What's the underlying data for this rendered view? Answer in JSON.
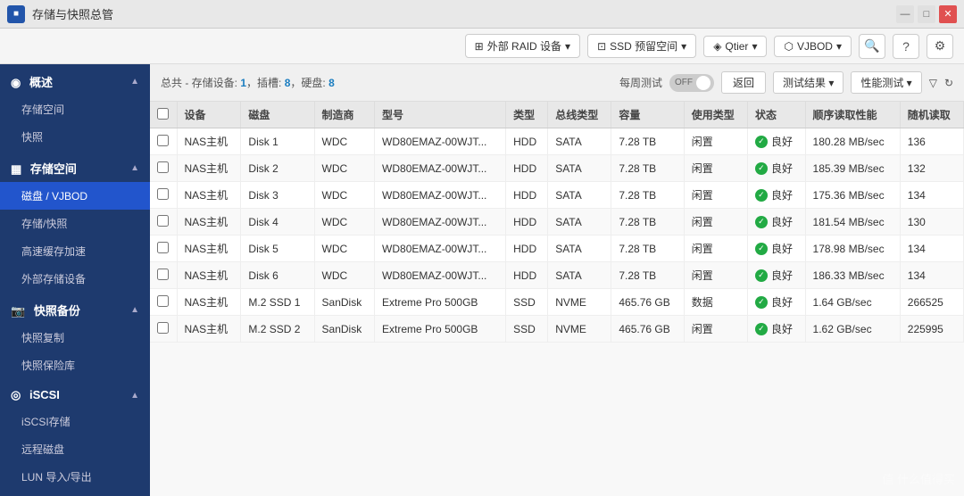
{
  "window": {
    "title": "存储与快照总管",
    "icon": "■",
    "buttons": {
      "minimize": "—",
      "maximize": "□",
      "close": "✕"
    }
  },
  "toolbar": {
    "btn1_label": "外部 RAID 设备",
    "btn2_label": "SSD 预留空间",
    "btn3_label": "Qtier",
    "btn4_label": "VJBOD",
    "icon1": "⚙",
    "icon2": "?",
    "icon3": "⚙"
  },
  "content_header": {
    "summary": "总共 - 存储设备: 1，插槽: 8，硬盘: 8",
    "label_test": "每周测试",
    "toggle": "OFF",
    "btn_return": "返回",
    "btn_test_result": "测试结果 ▾",
    "btn_performance": "性能测试 ▾"
  },
  "table": {
    "columns": [
      "",
      "设备",
      "磁盘",
      "制造商",
      "型号",
      "类型",
      "总线类型",
      "容量",
      "使用类型",
      "状态",
      "顺序读取性能",
      "随机读取"
    ],
    "rows": [
      {
        "checked": false,
        "device": "NAS主机",
        "disk": "Disk 1",
        "manufacturer": "WDC",
        "model": "WD80EMAZ-00WJT...",
        "type": "HDD",
        "bus": "SATA",
        "capacity": "7.28 TB",
        "usage": "闲置",
        "status": "良好",
        "seq_read": "180.28 MB/sec",
        "rand_read": "136"
      },
      {
        "checked": false,
        "device": "NAS主机",
        "disk": "Disk 2",
        "manufacturer": "WDC",
        "model": "WD80EMAZ-00WJT...",
        "type": "HDD",
        "bus": "SATA",
        "capacity": "7.28 TB",
        "usage": "闲置",
        "status": "良好",
        "seq_read": "185.39 MB/sec",
        "rand_read": "132"
      },
      {
        "checked": false,
        "device": "NAS主机",
        "disk": "Disk 3",
        "manufacturer": "WDC",
        "model": "WD80EMAZ-00WJT...",
        "type": "HDD",
        "bus": "SATA",
        "capacity": "7.28 TB",
        "usage": "闲置",
        "status": "良好",
        "seq_read": "175.36 MB/sec",
        "rand_read": "134"
      },
      {
        "checked": false,
        "device": "NAS主机",
        "disk": "Disk 4",
        "manufacturer": "WDC",
        "model": "WD80EMAZ-00WJT...",
        "type": "HDD",
        "bus": "SATA",
        "capacity": "7.28 TB",
        "usage": "闲置",
        "status": "良好",
        "seq_read": "181.54 MB/sec",
        "rand_read": "130"
      },
      {
        "checked": false,
        "device": "NAS主机",
        "disk": "Disk 5",
        "manufacturer": "WDC",
        "model": "WD80EMAZ-00WJT...",
        "type": "HDD",
        "bus": "SATA",
        "capacity": "7.28 TB",
        "usage": "闲置",
        "status": "良好",
        "seq_read": "178.98 MB/sec",
        "rand_read": "134"
      },
      {
        "checked": false,
        "device": "NAS主机",
        "disk": "Disk 6",
        "manufacturer": "WDC",
        "model": "WD80EMAZ-00WJT...",
        "type": "HDD",
        "bus": "SATA",
        "capacity": "7.28 TB",
        "usage": "闲置",
        "status": "良好",
        "seq_read": "186.33 MB/sec",
        "rand_read": "134"
      },
      {
        "checked": false,
        "device": "NAS主机",
        "disk": "M.2 SSD 1",
        "manufacturer": "SanDisk",
        "model": "Extreme Pro 500GB",
        "type": "SSD",
        "bus": "NVME",
        "capacity": "465.76 GB",
        "usage": "数据",
        "status": "良好",
        "seq_read": "1.64 GB/sec",
        "rand_read": "266525"
      },
      {
        "checked": false,
        "device": "NAS主机",
        "disk": "M.2 SSD 2",
        "manufacturer": "SanDisk",
        "model": "Extreme Pro 500GB",
        "type": "SSD",
        "bus": "NVME",
        "capacity": "465.76 GB",
        "usage": "闲置",
        "status": "良好",
        "seq_read": "1.62 GB/sec",
        "rand_read": "225995"
      }
    ]
  },
  "sidebar": {
    "sections": [
      {
        "id": "overview",
        "label": "概述",
        "icon": "◉",
        "expanded": true,
        "items": [
          {
            "id": "storage-space",
            "label": "存储空间"
          },
          {
            "id": "snapshot",
            "label": "快照"
          }
        ]
      },
      {
        "id": "storage-space",
        "label": "存储空间",
        "icon": "▦",
        "expanded": true,
        "items": [
          {
            "id": "disk-vjbod",
            "label": "磁盘 / VJBOD",
            "active": true
          },
          {
            "id": "storage-snapshot",
            "label": "存储/快照"
          },
          {
            "id": "high-speed-cache",
            "label": "高速缓存加速"
          },
          {
            "id": "external-storage",
            "label": "外部存储设备"
          }
        ]
      },
      {
        "id": "snapshot-backup",
        "label": "快照备份",
        "icon": "📷",
        "expanded": true,
        "items": [
          {
            "id": "snapshot-copy",
            "label": "快照复制"
          },
          {
            "id": "snapshot-vault",
            "label": "快照保险库"
          }
        ]
      },
      {
        "id": "iscsi",
        "label": "iSCSI",
        "icon": "◎",
        "expanded": true,
        "items": [
          {
            "id": "iscsi-storage",
            "label": "iSCSI存储"
          },
          {
            "id": "remote-disk",
            "label": "远程磁盘"
          },
          {
            "id": "lun-import-export",
            "label": "LUN 导入/导出"
          }
        ]
      }
    ]
  },
  "watermark": "值 什么值得买"
}
